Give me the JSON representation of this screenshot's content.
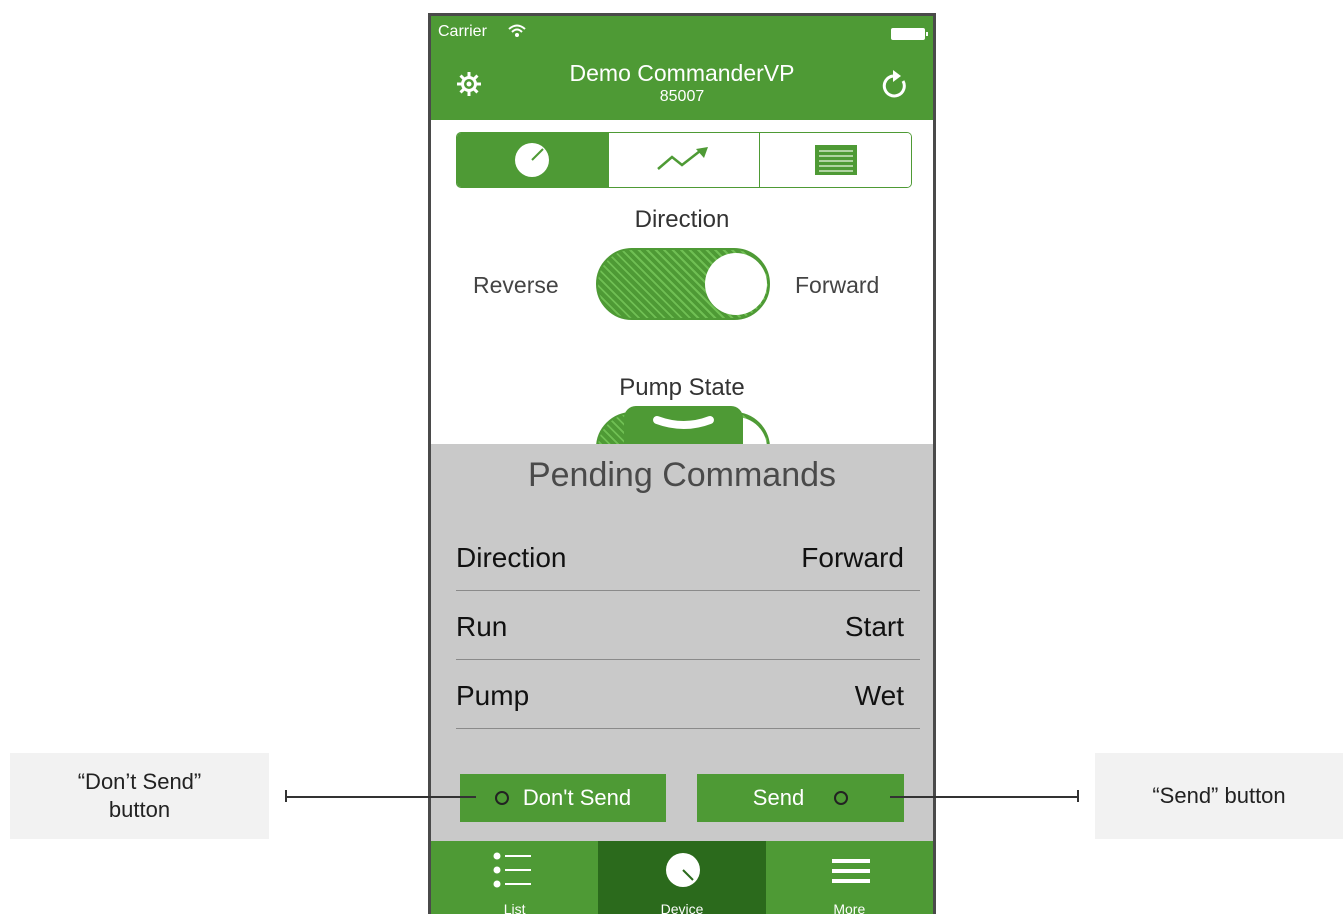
{
  "status_bar": {
    "carrier": "Carrier"
  },
  "header": {
    "title": "Demo CommanderVP",
    "subtitle": "85007"
  },
  "controls": {
    "direction": {
      "label": "Direction",
      "left": "Reverse",
      "right": "Forward"
    },
    "pump_state": {
      "label": "Pump State"
    }
  },
  "pending": {
    "title": "Pending Commands",
    "rows": [
      {
        "name": "Direction",
        "value": "Forward"
      },
      {
        "name": "Run",
        "value": "Start"
      },
      {
        "name": "Pump",
        "value": "Wet"
      }
    ],
    "dont_send_label": "Don't Send",
    "send_label": "Send"
  },
  "tabs": [
    {
      "label": "List",
      "icon": "list-icon"
    },
    {
      "label": "Device",
      "icon": "device-gauge-icon"
    },
    {
      "label": "More",
      "icon": "menu-icon"
    }
  ],
  "callouts": {
    "dont_send": "“Don’t Send” button",
    "send": "“Send” button"
  },
  "colors": {
    "brand_green": "#4e9a35",
    "active_tab": "#2b6a1c",
    "sheet_bg": "#c9c9c9"
  }
}
